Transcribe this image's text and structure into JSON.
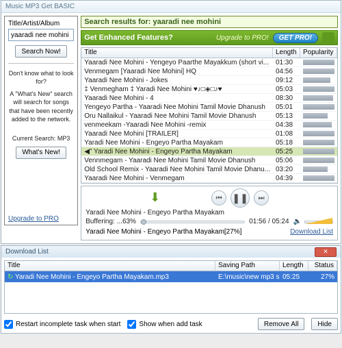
{
  "app": {
    "title": "Music MP3 Get BASIC"
  },
  "left": {
    "searchLabel": "Title/Artist/Album",
    "searchValue": "yaaradi nee mohini",
    "searchBtn": "Search Now!",
    "helpTitle": "Don't know what to look for?",
    "helpText": "A \"What's New\" search will search for songs that have been recently added to the network.",
    "currentSearch": "Current Search: MP3",
    "whatsNewBtn": "What's New!",
    "upgradeLink": "Upgrade to PRO"
  },
  "promo": {
    "searchFor": "Search results for: yaaradi nee mohini",
    "enhanced": "Get Enhanced Features?",
    "upgrade": "Upgrade to PRO!",
    "getPro": "GET PRO!"
  },
  "columns": {
    "title": "Title",
    "length": "Length",
    "popularity": "Popularity"
  },
  "results": [
    {
      "sel": false,
      "title": "Yaaradi Nee Mohini - Yengeyo Paarthe Mayakkum (short vi...",
      "len": "01:30",
      "pop": 54
    },
    {
      "sel": false,
      "title": "Venmegam [Yaaradi Nee Mohini] HQ",
      "len": "04:56",
      "pop": 52
    },
    {
      "sel": false,
      "title": "Yaaradi Nee Mohini - Jokes",
      "len": "09:12",
      "pop": 40
    },
    {
      "sel": false,
      "title": "‡ Venmegham ‡ Yaradi Nee Mohini ♥♪□◈□♪♥",
      "len": "05:03",
      "pop": 46
    },
    {
      "sel": false,
      "title": "Yaaradi Nee Mohini - 4",
      "len": "08:30",
      "pop": 44
    },
    {
      "sel": false,
      "title": "Yengeyo Partha - Yaaradi Nee Mohini Tamil Movie Dhanush",
      "len": "05:01",
      "pop": 48
    },
    {
      "sel": false,
      "title": "Oru Nallaikul - Yaaradi Nee Mohini Tamil Movie Dhanush",
      "len": "05:13",
      "pop": 36
    },
    {
      "sel": false,
      "title": "venmeekam -Yaaradi Nee Mohini -remix",
      "len": "04:38",
      "pop": 42
    },
    {
      "sel": false,
      "title": "Yaaradi Nee Mohini [TRAILER]",
      "len": "01:08",
      "pop": 48
    },
    {
      "sel": false,
      "title": "Yaradi Nee Mohini - Engeyo Partha Mayakam",
      "len": "05:18",
      "pop": 50
    },
    {
      "sel": true,
      "title": "◀\" Yaradi Nee Mohini - Engeyo Partha Mayakam",
      "len": "05:25",
      "pop": 50
    },
    {
      "sel": false,
      "title": "Vennmegam - Yaaradi Nee Mohini Tamil Movie Dhanush",
      "len": "05:06",
      "pop": 46
    },
    {
      "sel": false,
      "title": "Old School Remix - Yaaradi Nee Mohini Tamil Movie Dhanu...",
      "len": "03:20",
      "pop": 36
    },
    {
      "sel": false,
      "title": "Yaaradi Nee Mohini - Venmegam",
      "len": "04:39",
      "pop": 48
    }
  ],
  "player": {
    "nowPlaying": "Yaradi Nee Mohini - Engeyo Partha Mayakam",
    "buffering": "Buffering: ...63%",
    "time": "01:56 / 05:24",
    "status": "Yaradi Nee Mohini - Engeyo Partha Mayakam[27%]",
    "downloadList": "Download List"
  },
  "download": {
    "title": "Download List",
    "columns": {
      "title": "Title",
      "path": "Saving Path",
      "length": "Length",
      "status": "Status"
    },
    "rows": [
      {
        "title": "Yaradi Nee Mohini - Engeyo Partha Mayakam.mp3",
        "path": "E:\\music\\new mp3 s...",
        "len": "05:25",
        "status": "27%"
      }
    ],
    "chkRestart": "Restart incomplete task when start",
    "chkShow": "Show when add task",
    "removeBtn": "Remove All",
    "hideBtn": "Hide"
  }
}
